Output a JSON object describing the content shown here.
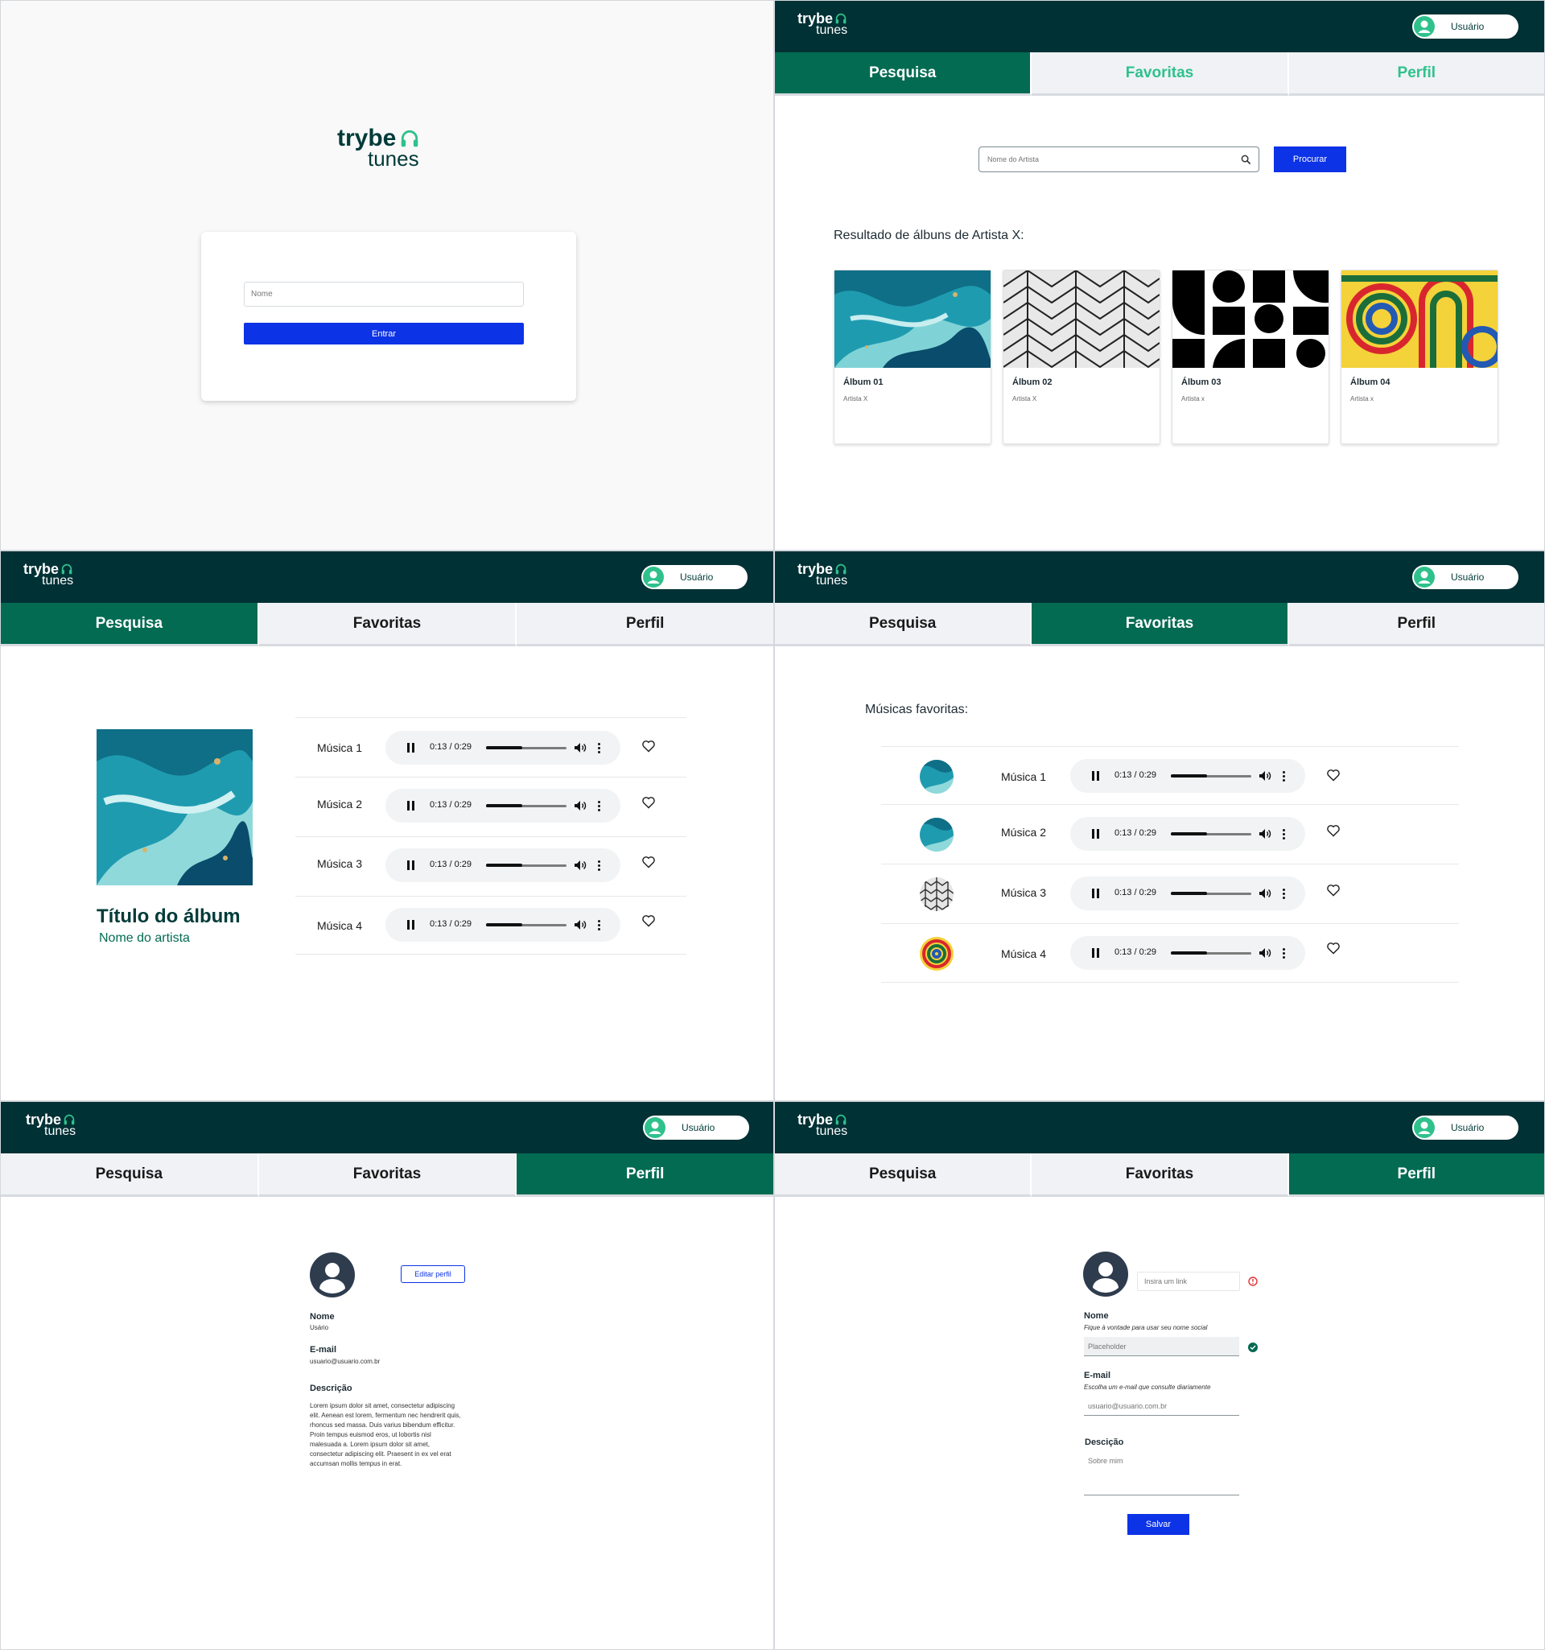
{
  "brand": {
    "line1": "trybe",
    "line2": "tunes"
  },
  "header": {
    "user": "Usuário"
  },
  "tabs": {
    "search": "Pesquisa",
    "favorites": "Favoritas",
    "profile": "Perfil"
  },
  "login": {
    "name_placeholder": "Nome",
    "submit": "Entrar"
  },
  "search": {
    "placeholder": "Nome do Artista",
    "button": "Procurar",
    "result_title": "Resultado de álbuns de Artista X:",
    "albums": [
      {
        "title": "Álbum 01",
        "artist": "Artista X"
      },
      {
        "title": "Álbum 02",
        "artist": "Artista X"
      },
      {
        "title": "Álbum 03",
        "artist": "Artista x"
      },
      {
        "title": "Álbum 04",
        "artist": "Artista x"
      }
    ]
  },
  "album": {
    "title": "Título do álbum",
    "artist": "Nome do artista",
    "tracks": [
      {
        "name": "Música 1",
        "time": "0:13 / 0:29",
        "progress": 0.45
      },
      {
        "name": "Música 2",
        "time": "0:13 / 0:29",
        "progress": 0.45
      },
      {
        "name": "Música 3",
        "time": "0:13 / 0:29",
        "progress": 0.45
      },
      {
        "name": "Música 4",
        "time": "0:13 / 0:29",
        "progress": 0.45
      }
    ]
  },
  "favorites": {
    "title": "Músicas favoritas:",
    "tracks": [
      {
        "name": "Música 1",
        "time": "0:13 / 0:29",
        "progress": 0.45,
        "art": "marble"
      },
      {
        "name": "Música 2",
        "time": "0:13 / 0:29",
        "progress": 0.45,
        "art": "marble"
      },
      {
        "name": "Música 3",
        "time": "0:13 / 0:29",
        "progress": 0.45,
        "art": "hexagon"
      },
      {
        "name": "Música 4",
        "time": "0:13 / 0:29",
        "progress": 0.45,
        "art": "colorful"
      }
    ]
  },
  "profile": {
    "edit_button": "Editar perfil",
    "name_label": "Nome",
    "name_value": "Usário",
    "email_label": "E-mail",
    "email_value": "usuario@usuario.com.br",
    "description_label": "Descrição",
    "description_text": "Lorem ipsum dolor sit amet, consectetur adipiscing elit. Aenean est lorem, fermentum nec hendrerit quis, rhoncus sed massa. Duis varius bibendum efficitur. Proin tempus euismod eros, ut lobortis nisl malesuada a. Lorem ipsum dolor sit amet, consectetur adipiscing elit. Praesent in ex vel erat accumsan mollis tempus in erat."
  },
  "profile_edit": {
    "image_placeholder": "Insira um link",
    "name_label": "Nome",
    "name_hint": "Fique à vontade para usar seu nome social",
    "name_placeholder": "Placeholder",
    "email_label": "E-mail",
    "email_hint": "Escolha um e-mail que consulte diariamente",
    "email_placeholder": "usuario@usuario.com.br",
    "description_label": "Descição",
    "description_placeholder": "Sobre mim",
    "save_button": "Salvar"
  },
  "colors": {
    "header_bg": "#003135",
    "tab_active": "#036b52",
    "tab_inactive": "#f0f2f5",
    "brand_green": "#2fc18c",
    "primary_blue": "#0d33e6",
    "error": "#e03131"
  }
}
